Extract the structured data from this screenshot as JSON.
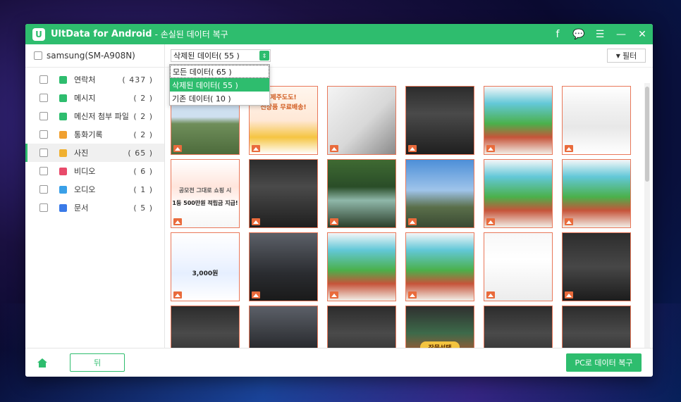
{
  "app": {
    "name": "UltData for Android",
    "subtitle": "- 손실된 데이터 복구",
    "logo_letter": "U"
  },
  "titlebar": {
    "facebook_glyph": "f",
    "feedback_glyph": "💬",
    "menu_glyph": "☰",
    "minimize_glyph": "—",
    "close_glyph": "✕"
  },
  "device": {
    "name": "samsung(SM-A908N)"
  },
  "categories": [
    {
      "label": "연락처",
      "count": "( 437 )",
      "color": "#2ebd6e",
      "icon": "contacts-icon"
    },
    {
      "label": "메시지",
      "count": "( 2 )",
      "color": "#2ebd6e",
      "icon": "message-icon"
    },
    {
      "label": "메신저 첨부 파일",
      "count": "( 2 )",
      "color": "#2ebd6e",
      "icon": "attachment-icon"
    },
    {
      "label": "통화기록",
      "count": "( 2 )",
      "color": "#f0a030",
      "icon": "call-log-icon"
    },
    {
      "label": "사진",
      "count": "( 65 )",
      "color": "#f0b030",
      "icon": "photo-icon"
    },
    {
      "label": "비디오",
      "count": "( 6 )",
      "color": "#e84a6a",
      "icon": "video-icon"
    },
    {
      "label": "오디오",
      "count": "( 1 )",
      "color": "#3aa0e8",
      "icon": "audio-icon"
    },
    {
      "label": "문서",
      "count": "( 5 )",
      "color": "#3a7ae8",
      "icon": "document-icon"
    }
  ],
  "toolbar": {
    "select_value": "삭제된 데이터( 55 )",
    "filter_label": "필터",
    "filter_glyph": "▼"
  },
  "dropdown_options": [
    "모든 데이터( 65 )",
    "삭제된 데이터( 55 )",
    "기존 데이터( 10 )"
  ],
  "thumbnail_texts": {
    "promo_banner": "전상품 무료배송!",
    "promo_heading": "제주도도!",
    "promo2_sub": "공모전 그대로 쇼핑 시",
    "promo2_big": "1등 500만원 적립금 지급!",
    "app_amount": "3,000원",
    "game2_button": "작물선택"
  },
  "footer": {
    "back_label": "뒤",
    "recover_label": "PC로 데이터 복구"
  },
  "colors": {
    "accent": "#2ebd6e",
    "thumb_border": "#e9785a"
  }
}
